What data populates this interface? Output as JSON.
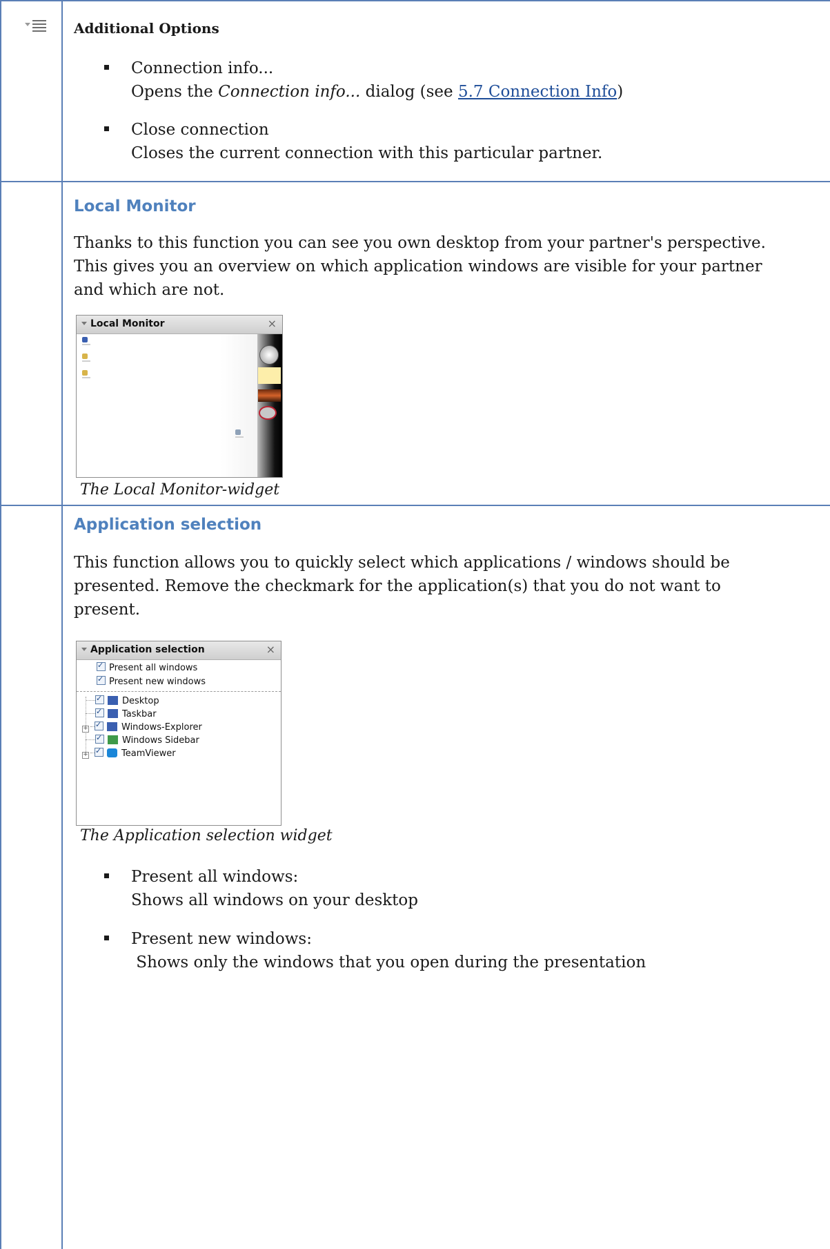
{
  "additional_options": {
    "title": "Additional Options",
    "items": [
      {
        "label": "Connection info...",
        "desc_prefix": "Opens the ",
        "desc_italic": "Connection info...",
        "desc_mid": " dialog (see ",
        "link": "5.7 Connection Info",
        "desc_suffix": ")"
      },
      {
        "label": "Close connection",
        "description": "Closes the current connection with this particular partner."
      }
    ]
  },
  "local_monitor": {
    "heading": "Local Monitor",
    "lines": [
      "Thanks to this function you can see you own desktop from your partner's perspective.",
      "This gives you an overview on which application windows are visible for your partner",
      "and which are not."
    ],
    "widget_title": "Local Monitor",
    "close_glyph": "×",
    "caption": "The Local Monitor-widget"
  },
  "application_selection": {
    "heading": "Application selection",
    "lines": [
      "This function allows you to quickly select which applications / windows should be",
      "presented. Remove the checkmark for the application(s) that you do not want to",
      "present."
    ],
    "widget_title": "Application selection",
    "close_glyph": "×",
    "checkbox_options": [
      "Present all windows",
      "Present new windows"
    ],
    "tree_items": [
      {
        "label": "Desktop",
        "expandable": false,
        "icon_color": "#3a5fb0"
      },
      {
        "label": "Taskbar",
        "expandable": false,
        "icon_color": "#3a5fb0"
      },
      {
        "label": "Windows-Explorer",
        "expandable": true,
        "icon_color": "#3a5fb0"
      },
      {
        "label": "Windows Sidebar",
        "expandable": false,
        "icon_color": "#3f9a4a"
      },
      {
        "label": "TeamViewer",
        "expandable": true,
        "icon_color": "#1a86d8"
      }
    ],
    "caption": "The Application selection widget",
    "bullets": [
      {
        "label": "Present all windows:",
        "description": "Shows all windows on your desktop"
      },
      {
        "label": "Present new windows:",
        "description": " Shows only the windows that you open during the presentation"
      }
    ]
  },
  "colors": {
    "heading": "#4f81bd",
    "grid": "#5a7fb6",
    "link": "#1f4e99"
  }
}
